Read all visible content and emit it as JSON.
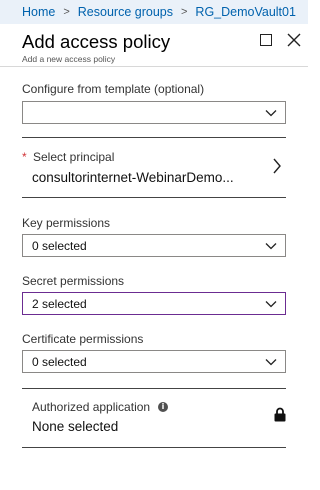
{
  "breadcrumb": {
    "items": [
      "Home",
      "Resource groups",
      "RG_DemoVault01"
    ],
    "separator": ">"
  },
  "blade": {
    "title": "Add access policy",
    "subtitle": "Add a new access policy"
  },
  "form": {
    "template": {
      "label": "Configure from template (optional)",
      "value": ""
    },
    "principal": {
      "required_mark": "*",
      "label": "Select principal",
      "value": "consultorinternet-WebinarDemo..."
    },
    "key_permissions": {
      "label": "Key permissions",
      "value": "0 selected"
    },
    "secret_permissions": {
      "label": "Secret permissions",
      "value": "2 selected"
    },
    "certificate_permissions": {
      "label": "Certificate permissions",
      "value": "0 selected"
    },
    "authorized_application": {
      "label": "Authorized application",
      "info": "i",
      "value": "None selected"
    }
  },
  "icons": {
    "maximize": "maximize-icon",
    "close": "close-icon",
    "chevron": "chevron-down-icon",
    "arrow": "chevron-right-icon",
    "lock": "lock-icon",
    "info": "info-icon"
  },
  "colors": {
    "breadcrumb_bg": "#eaf1f9",
    "link": "#0062ad",
    "required": "#d13438",
    "active_border": "#6b2c91"
  }
}
